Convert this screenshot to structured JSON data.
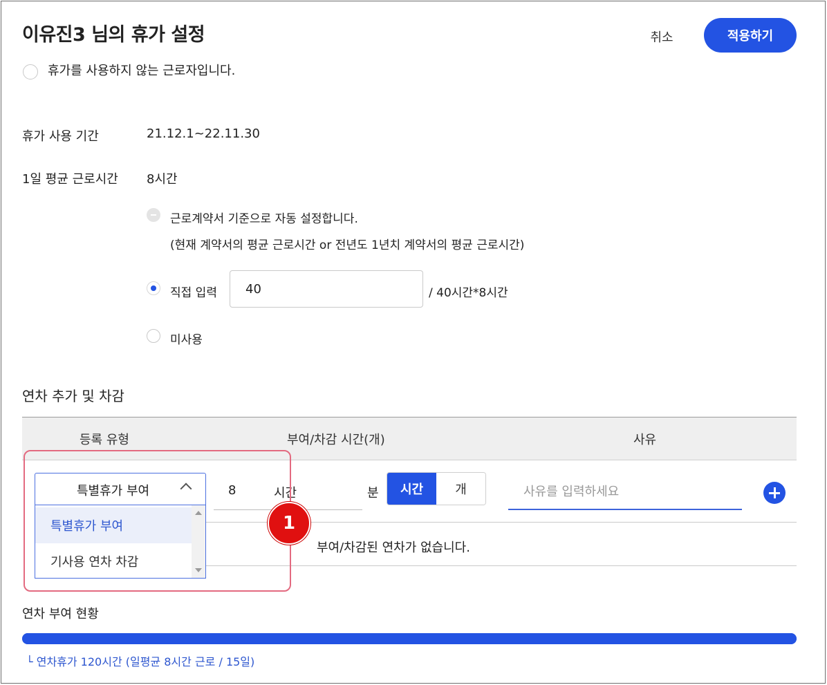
{
  "header": {
    "title": "이유진3 님의 휴가 설정",
    "cancel_label": "취소",
    "apply_label": "적용하기"
  },
  "no_leave_option": {
    "label": "휴가를 사용하지 않는 근로자입니다.",
    "checked": false
  },
  "period": {
    "label": "휴가 사용 기간",
    "value": "21.12.1~22.11.30"
  },
  "avg_hours": {
    "label": "1일 평균 근로시간",
    "value": "8시간",
    "options": [
      {
        "label": "근로계약서 기준으로 자동 설정합니다.",
        "sub": "(현재 계약서의 평균 근로시간 or 전년도 1년치 계약서의 평균 근로시간)",
        "state": "disabled"
      },
      {
        "label": "직접 입력",
        "input_value": "40",
        "suffix": "/ 40시간*8시간",
        "state": "checked"
      },
      {
        "label": "미사용",
        "state": "unchecked"
      }
    ]
  },
  "adjust": {
    "section_title": "연차 추가 및 차감",
    "columns": [
      "등록 유형",
      "부여/차감 시간(개)",
      "사유"
    ],
    "row": {
      "type_selected": "특별휴가 부여",
      "hours": "8",
      "hours_unit": "시간",
      "minutes_unit": "분",
      "unit_toggle": [
        "시간",
        "개"
      ],
      "unit_active": "시간",
      "reason_placeholder": "사유를 입력하세요"
    },
    "dropdown_options": [
      "특별휴가 부여",
      "기사용 연차 차감"
    ],
    "empty_message": "부여/차감된 연차가 없습니다."
  },
  "callout_number": "1",
  "status": {
    "section_title": "연차 부여 현황",
    "progress_percent": 100,
    "note": "└ 연차휴가 120시간 (일평균 8시간 근로 / 15일)"
  },
  "colors": {
    "accent": "#2353e3",
    "callout": "#e01010",
    "highlight": "#e36a80"
  }
}
